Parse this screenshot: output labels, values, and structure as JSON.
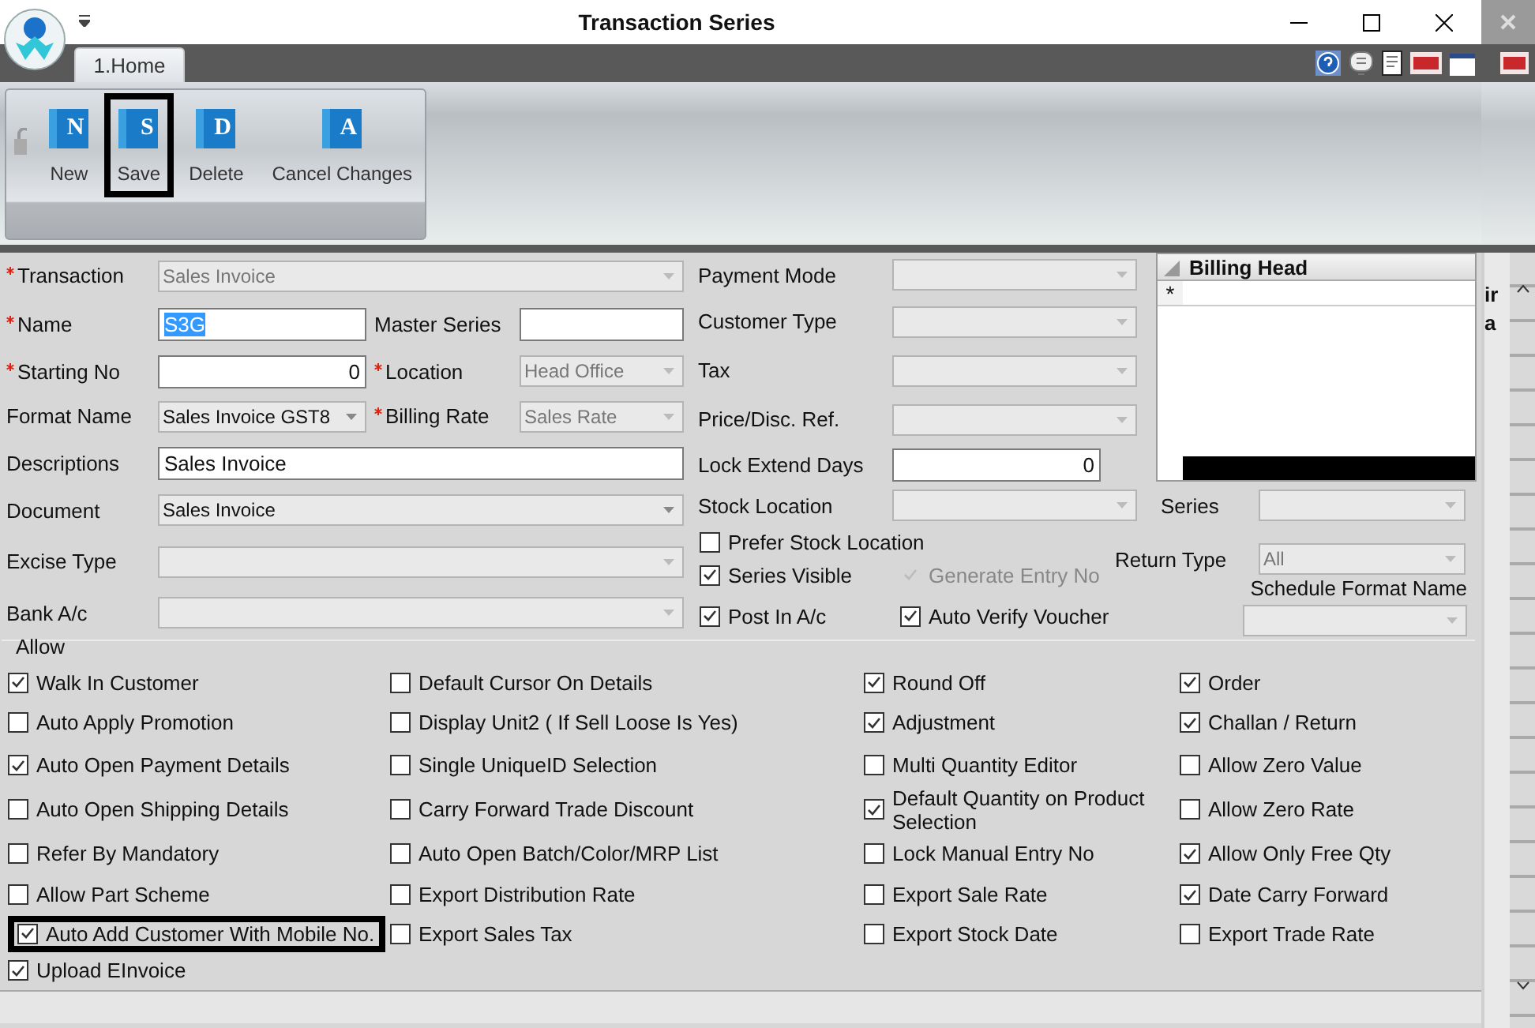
{
  "window": {
    "title": "Transaction Series"
  },
  "ribbon": {
    "tabs": [
      {
        "label": "1.Home",
        "selected": true
      }
    ],
    "buttons": [
      {
        "label": "New",
        "icon_letter": "N",
        "highlighted": false
      },
      {
        "label": "Save",
        "icon_letter": "S",
        "highlighted": true
      },
      {
        "label": "Delete",
        "icon_letter": "D",
        "highlighted": false
      },
      {
        "label": "Cancel Changes",
        "icon_letter": "A",
        "highlighted": false
      }
    ]
  },
  "form": {
    "left_rows": [
      {
        "label": "Transaction",
        "required": true,
        "control": {
          "kind": "combo",
          "value": "Sales Invoice",
          "disabled": true
        }
      },
      {
        "label": "Name",
        "required": true,
        "control": {
          "kind": "text",
          "value": "S3G",
          "text_selected": true
        },
        "extra": {
          "label": "Master Series",
          "required": false,
          "control": {
            "kind": "text"
          }
        }
      },
      {
        "label": "Starting No",
        "required": true,
        "control": {
          "kind": "number",
          "value": "0"
        },
        "extra": {
          "label": "Location",
          "required": true,
          "control": {
            "kind": "combo",
            "value": "Head Office",
            "disabled": true
          }
        }
      },
      {
        "label": "Format Name",
        "required": false,
        "control": {
          "kind": "combo",
          "value": "Sales Invoice GST8",
          "disabled": false
        },
        "extra": {
          "label": "Billing Rate",
          "required": true,
          "control": {
            "kind": "combo",
            "value": "Sales Rate",
            "disabled": true
          }
        }
      },
      {
        "label": "Descriptions",
        "required": false,
        "control": {
          "kind": "text",
          "value": "Sales Invoice",
          "text_selected": false
        }
      },
      {
        "label": "Document",
        "required": false,
        "control": {
          "kind": "combo",
          "value": "Sales Invoice",
          "disabled": false
        }
      },
      {
        "label": "Excise Type",
        "required": false,
        "control": {
          "kind": "combo",
          "disabled": true
        }
      },
      {
        "label": "Bank A/c",
        "required": false,
        "control": {
          "kind": "combo",
          "disabled": true
        }
      }
    ],
    "middle_rows": [
      {
        "label": "Payment Mode",
        "control": {
          "kind": "combo",
          "disabled": true
        }
      },
      {
        "label": "Customer Type",
        "control": {
          "kind": "combo",
          "disabled": true
        }
      },
      {
        "label": "Tax",
        "control": {
          "kind": "combo",
          "disabled": true
        }
      },
      {
        "label": "Price/Disc. Ref.",
        "control": {
          "kind": "combo",
          "disabled": true
        }
      },
      {
        "label": "Lock Extend Days",
        "control": {
          "kind": "number",
          "value": "0"
        }
      },
      {
        "label": "Stock Location",
        "control": {
          "kind": "combo",
          "disabled": true
        }
      }
    ],
    "middle_checks": [
      {
        "label": "Prefer Stock Location",
        "checked": false,
        "disabled": false
      },
      {
        "label": "Series Visible",
        "checked": true,
        "disabled": false
      },
      {
        "label": "Generate Entry No",
        "checked": true,
        "disabled": true
      },
      {
        "label": "Post In A/c",
        "checked": true,
        "disabled": false
      },
      {
        "label": "Auto Verify Voucher",
        "checked": true,
        "disabled": false
      }
    ],
    "billing_head": {
      "title": "Billing Head",
      "new_row_marker": "*"
    },
    "series": {
      "label": "Series",
      "control": {
        "kind": "combo",
        "disabled": true
      }
    },
    "return_type": {
      "label": "Return Type",
      "control": {
        "kind": "combo",
        "value": "All",
        "disabled": true
      }
    },
    "schedule_format": {
      "label": "Schedule Format Name",
      "control": {
        "kind": "combo",
        "disabled": true
      }
    },
    "allow": {
      "label": "Allow",
      "columns": [
        [
          {
            "label": "Walk In Customer",
            "checked": true,
            "highlighted": false
          },
          {
            "label": "Auto Apply Promotion",
            "checked": false,
            "highlighted": false
          },
          {
            "label": "Auto Open Payment Details",
            "checked": true,
            "highlighted": false
          },
          {
            "label": "Auto Open Shipping Details",
            "checked": false,
            "highlighted": false
          },
          {
            "label": "Refer By Mandatory",
            "checked": false,
            "highlighted": false
          },
          {
            "label": "Allow Part Scheme",
            "checked": false,
            "highlighted": false
          },
          {
            "label": "Auto Add Customer With Mobile No.",
            "checked": true,
            "highlighted": true
          },
          {
            "label": "Upload EInvoice",
            "checked": true,
            "highlighted": false
          }
        ],
        [
          {
            "label": "Default Cursor On Details",
            "checked": false,
            "highlighted": false
          },
          {
            "label": "Display Unit2 ( If Sell Loose Is Yes)",
            "checked": false,
            "highlighted": false
          },
          {
            "label": "Single UniqueID Selection",
            "checked": false,
            "highlighted": false
          },
          {
            "label": "Carry Forward Trade Discount",
            "checked": false,
            "highlighted": false
          },
          {
            "label": "Auto Open Batch/Color/MRP List",
            "checked": false,
            "highlighted": false
          },
          {
            "label": "Export Distribution Rate",
            "checked": false,
            "highlighted": false
          },
          {
            "label": "Export Sales Tax",
            "checked": false,
            "highlighted": false
          }
        ],
        [
          {
            "label": "Round Off",
            "checked": true,
            "highlighted": false
          },
          {
            "label": "Adjustment",
            "checked": true,
            "highlighted": false
          },
          {
            "label": "Multi Quantity Editor",
            "checked": false,
            "highlighted": false
          },
          {
            "label": "Default Quantity on Product Selection",
            "checked": true,
            "highlighted": false
          },
          {
            "label": "Lock Manual Entry No",
            "checked": false,
            "highlighted": false
          },
          {
            "label": "Export Sale Rate",
            "checked": false,
            "highlighted": false
          },
          {
            "label": "Export Stock Date",
            "checked": false,
            "highlighted": false
          }
        ],
        [
          {
            "label": "Order",
            "checked": true,
            "highlighted": false
          },
          {
            "label": "Challan / Return",
            "checked": true,
            "highlighted": false
          },
          {
            "label": "Allow Zero Value",
            "checked": false,
            "highlighted": false
          },
          {
            "label": "Allow Zero Rate",
            "checked": false,
            "highlighted": false
          },
          {
            "label": "Allow Only Free Qty",
            "checked": true,
            "highlighted": false
          },
          {
            "label": "Date Carry Forward",
            "checked": true,
            "highlighted": false
          },
          {
            "label": "Export Trade Rate",
            "checked": false,
            "highlighted": false
          }
        ]
      ]
    }
  },
  "background_window": {
    "cut_texts": [
      "ir",
      "a"
    ]
  }
}
